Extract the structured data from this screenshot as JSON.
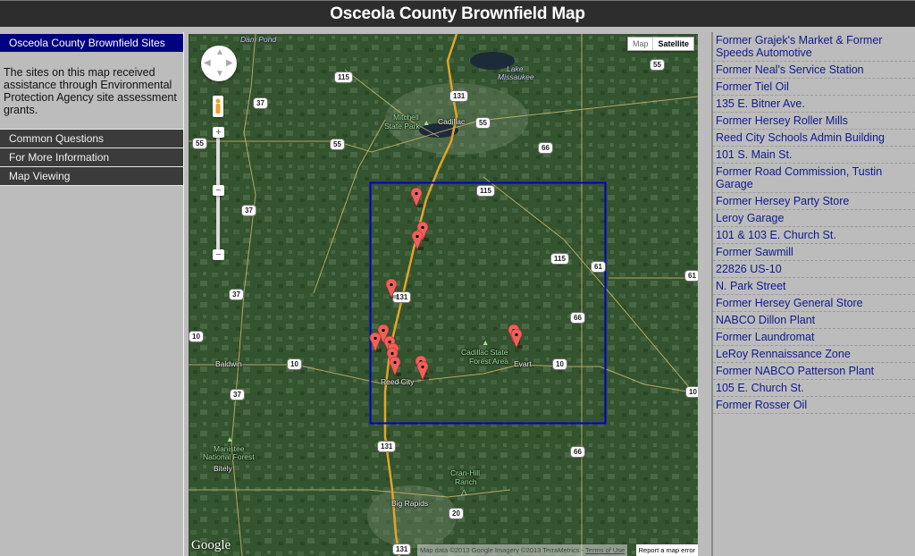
{
  "header": {
    "title": "Osceola County Brownfield Map"
  },
  "left_panel": {
    "active_section": "Osceola County Brownfield Sites",
    "intro_text": "The sites on this map received assistance through Environmental Protection Agency site assessment grants.",
    "nav_items": [
      "Common Questions",
      "For More Information",
      "Map Viewing"
    ]
  },
  "map": {
    "type_buttons": {
      "map": "Map",
      "satellite": "Satellite"
    },
    "selected_type": "Satellite",
    "zoom_in": "+",
    "zoom_out": "−",
    "zoom_level_mark": "−",
    "google_logo": "Google",
    "attribution": "Map data ©2013 Google Imagery ©2013 TerraMetrics - ",
    "terms_link": "Terms of Use",
    "report_link": "Report a map error",
    "boundary_color": "#0000c8",
    "marker_color": "#f0605a",
    "place_labels": {
      "dam_pond": "Dam Pond",
      "lake_missaukee_1": "Lake",
      "lake_missaukee_2": "Missaukee",
      "mitchell_1": "Mitchell",
      "mitchell_2": "State Park",
      "cadillac": "Cadillac",
      "cadillac_forest_1": "Cadillac State",
      "cadillac_forest_2": "Forest Area",
      "baldwin": "Baldwin",
      "reed_city": "Reed City",
      "evart": "Evart",
      "manistee_1": "Manistee",
      "manistee_2": "National Forest",
      "bitely": "Bitely",
      "cranhill_1": "Cran-Hill",
      "cranhill_2": "Ranch",
      "big_rapids": "Big Rapids"
    },
    "route_shields": {
      "r115a": "115",
      "r55a": "55",
      "r131a": "131",
      "r55b": "55",
      "r37a": "37",
      "r55c": "55",
      "r66a": "66",
      "r55d": "55",
      "r115b": "115",
      "r37b": "37",
      "r131b": "131",
      "r115c": "115",
      "r61a": "61",
      "r61b": "61",
      "r37c": "37",
      "r66b": "66",
      "r10a": "10",
      "r10b": "10",
      "r10c": "10",
      "r10d": "10",
      "r37d": "37",
      "r131c": "131",
      "r66c": "66",
      "r20": "20",
      "r131d": "131"
    },
    "marker_count": 14
  },
  "sites": [
    "Former Grajek's Market & Former Speeds Automotive",
    "Former Neal's Service Station",
    "Former Tiel Oil",
    "135 E. Bitner Ave.",
    "Former Hersey Roller Mills",
    "Reed City Schools Admin Building",
    "101 S. Main St.",
    "Former Road Commission, Tustin Garage",
    "Former Hersey Party Store",
    "Leroy Garage",
    "101 & 103 E. Church St.",
    "Former Sawmill",
    "22826 US-10",
    "N. Park Street",
    "Former Hersey General Store",
    "NABCO Dillon Plant",
    "Former Laundromat",
    "LeRoy Rennaissance Zone",
    "Former NABCO Patterson Plant",
    "105 E. Church St.",
    "Former Rosser Oil"
  ]
}
